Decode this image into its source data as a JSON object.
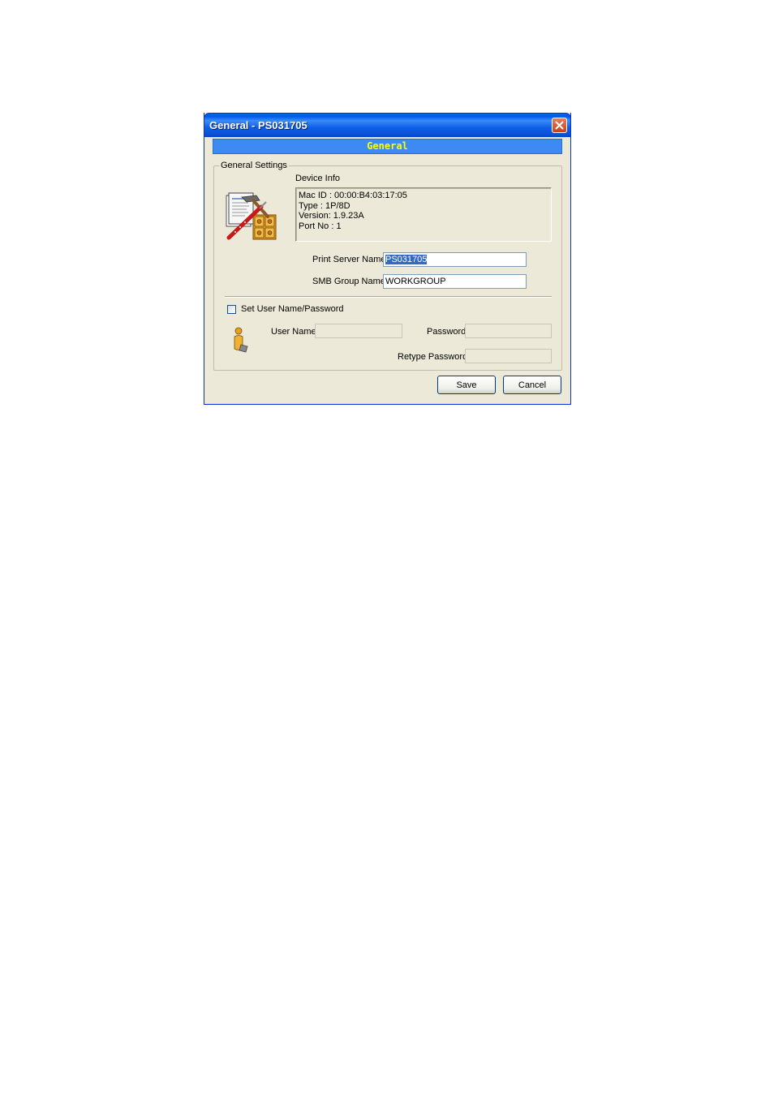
{
  "window": {
    "title": "General - PS031705"
  },
  "header": {
    "text": "General"
  },
  "general_settings": {
    "group_label": "General Settings",
    "device_info": {
      "label": "Device Info",
      "mac": "Mac ID : 00:00:B4:03:17:05",
      "type": "Type : 1P/8D",
      "version": "Version: 1.9.23A",
      "port": "Port No : 1"
    },
    "print_server_name": {
      "label": "Print Server Name",
      "value": "PS031705"
    },
    "smb_group_name": {
      "label": "SMB Group Name",
      "value": "WORKGROUP"
    },
    "set_user": {
      "label": "Set User Name/Password",
      "checked": false
    },
    "user_name": {
      "label": "User Name",
      "value": ""
    },
    "password": {
      "label": "Password",
      "value": ""
    },
    "retype_password": {
      "label": "Retype Password",
      "value": ""
    }
  },
  "buttons": {
    "save": "Save",
    "cancel": "Cancel"
  },
  "colors": {
    "titlebar": "#0a58e6",
    "header_bg": "#3d8bf2",
    "header_text": "#ffff00",
    "dialog_bg": "#ece9d8",
    "selection": "#316ac5"
  },
  "icons": [
    "tools-settings-icon",
    "user-info-icon",
    "close-icon"
  ]
}
